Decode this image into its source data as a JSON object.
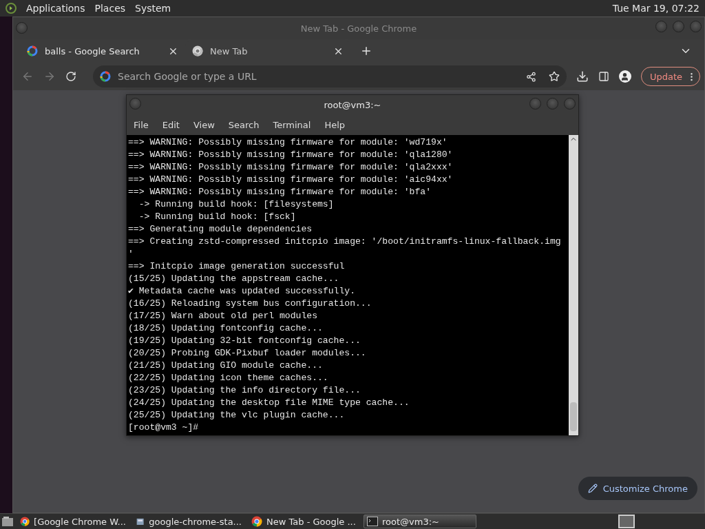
{
  "top_panel": {
    "menus": [
      "Applications",
      "Places",
      "System"
    ],
    "clock": "Tue Mar 19, 07:22"
  },
  "browser": {
    "title": "New Tab - Google Chrome",
    "tabs": [
      {
        "label": "balls - Google Search",
        "selected": false,
        "kind": "google"
      },
      {
        "label": "New Tab",
        "selected": true,
        "kind": "chrome"
      }
    ],
    "address": {
      "placeholder": "Search Google or type a URL"
    },
    "update_button": "Update",
    "customize_button": "Customize Chrome"
  },
  "terminal": {
    "title": "root@vm3:~",
    "menus": [
      "File",
      "Edit",
      "View",
      "Search",
      "Terminal",
      "Help"
    ],
    "lines": [
      "==> WARNING: Possibly missing firmware for module: 'wd719x'",
      "==> WARNING: Possibly missing firmware for module: 'qla1280'",
      "==> WARNING: Possibly missing firmware for module: 'qla2xxx'",
      "==> WARNING: Possibly missing firmware for module: 'aic94xx'",
      "==> WARNING: Possibly missing firmware for module: 'bfa'",
      "  -> Running build hook: [filesystems]",
      "  -> Running build hook: [fsck]",
      "==> Generating module dependencies",
      "==> Creating zstd-compressed initcpio image: '/boot/initramfs-linux-fallback.img",
      "'",
      "==> Initcpio image generation successful",
      "(15/25) Updating the appstream cache...",
      "✔ Metadata cache was updated successfully.",
      "(16/25) Reloading system bus configuration...",
      "(17/25) Warn about old perl modules",
      "(18/25) Updating fontconfig cache...",
      "(19/25) Updating 32-bit fontconfig cache...",
      "(20/25) Probing GDK-Pixbuf loader modules...",
      "(21/25) Updating GIO module cache...",
      "(22/25) Updating icon theme caches...",
      "(23/25) Updating the info directory file...",
      "(24/25) Updating the desktop file MIME type cache...",
      "(25/25) Updating the vlc plugin cache...",
      "[root@vm3 ~]#"
    ]
  },
  "taskbar": {
    "items": [
      {
        "label": "[Google Chrome W...",
        "selected": false,
        "kind": "chrome"
      },
      {
        "label": "google-chrome-sta...",
        "selected": false,
        "kind": "package"
      },
      {
        "label": "New Tab - Google ...",
        "selected": false,
        "kind": "chrome"
      },
      {
        "label": "root@vm3:~",
        "selected": true,
        "kind": "terminal"
      }
    ]
  }
}
